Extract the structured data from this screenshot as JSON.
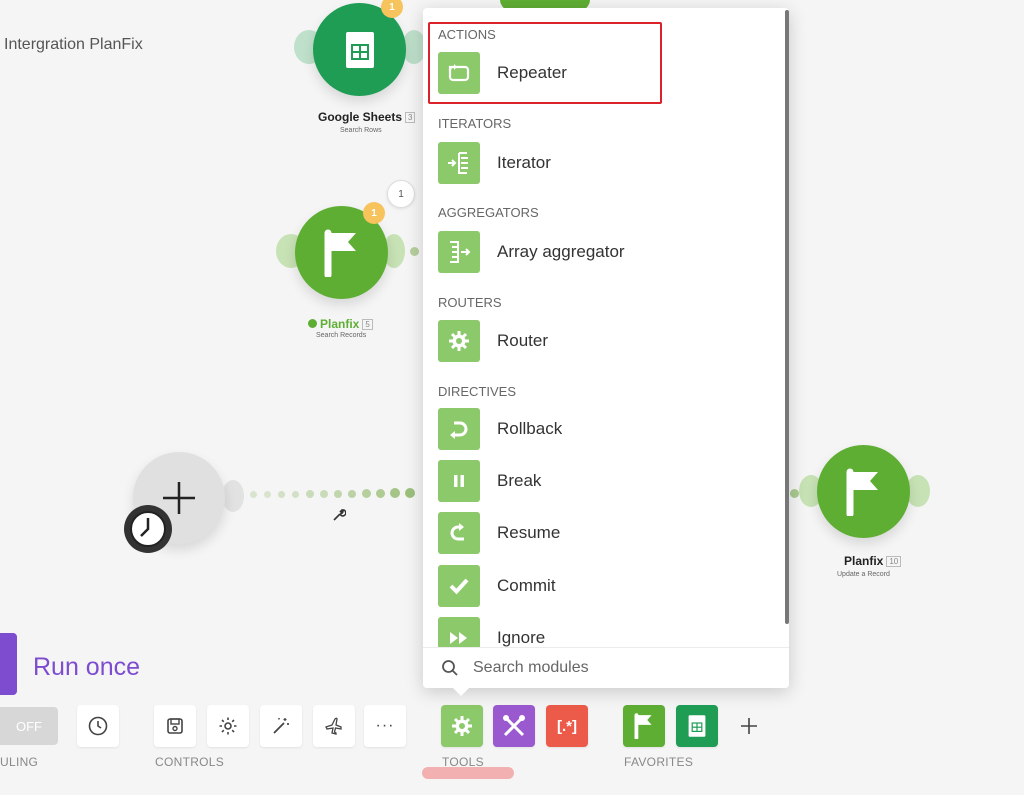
{
  "scenario": {
    "title": "Intergration PlanFix"
  },
  "modules": {
    "sheets_top": {
      "name": "Google Sheets",
      "id": "3",
      "subtitle": "Search Rows",
      "badge": "1"
    },
    "planfix_search": {
      "name": "Planfix",
      "id": "5",
      "subtitle": "Search Records",
      "badge": "1",
      "bubble": "1"
    },
    "planfix_update": {
      "name": "Planfix",
      "id": "10",
      "subtitle": "Update a Record"
    }
  },
  "popup": {
    "categories": [
      {
        "title": "ACTIONS",
        "items": [
          {
            "label": "Repeater",
            "icon": "repeat-icon"
          }
        ]
      },
      {
        "title": "ITERATORS",
        "items": [
          {
            "label": "Iterator",
            "icon": "iterator-icon"
          }
        ]
      },
      {
        "title": "AGGREGATORS",
        "items": [
          {
            "label": "Array aggregator",
            "icon": "aggregator-icon"
          }
        ]
      },
      {
        "title": "ROUTERS",
        "items": [
          {
            "label": "Router",
            "icon": "gear-icon"
          }
        ]
      },
      {
        "title": "DIRECTIVES",
        "items": [
          {
            "label": "Rollback",
            "icon": "rollback-icon"
          },
          {
            "label": "Break",
            "icon": "pause-icon"
          },
          {
            "label": "Resume",
            "icon": "resume-icon"
          },
          {
            "label": "Commit",
            "icon": "check-icon"
          },
          {
            "label": "Ignore",
            "icon": "fast-forward-icon"
          }
        ]
      }
    ],
    "search_placeholder": "Search modules"
  },
  "run_once": "Run once",
  "toolbar": {
    "toggle_label": "OFF",
    "scheduling_label": "ULING",
    "controls_label": "CONTROLS",
    "tools_label": "TOOLS",
    "favorites_label": "FAVORITES"
  },
  "colors": {
    "accent_green": "#8cc96a",
    "planfix_green": "#5fae34",
    "sheets_green": "#1f9d55",
    "purple": "#7d4ccf",
    "highlight_red": "#d9222a"
  }
}
